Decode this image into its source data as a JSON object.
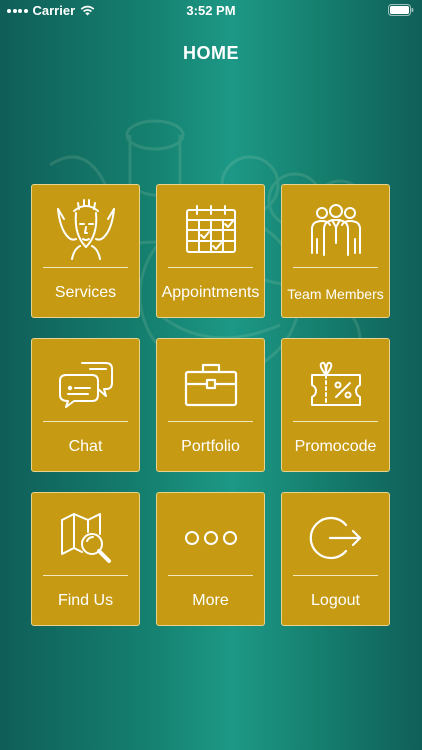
{
  "status_bar": {
    "carrier": "Carrier",
    "time": "3:52 PM"
  },
  "nav": {
    "title": "HOME"
  },
  "colors": {
    "tile_bg": "#c69a12",
    "tile_border": "#e9d48f",
    "background_center": "#1d9886",
    "background_edge": "#0f5e57"
  },
  "tiles": [
    {
      "label": "Services",
      "icon": "face-massage-icon"
    },
    {
      "label": "Appointments",
      "icon": "calendar-icon"
    },
    {
      "label": "Team Members",
      "icon": "team-icon"
    },
    {
      "label": "Chat",
      "icon": "chat-bubbles-icon"
    },
    {
      "label": "Portfolio",
      "icon": "briefcase-icon"
    },
    {
      "label": "Promocode",
      "icon": "gift-coupon-icon"
    },
    {
      "label": "Find Us",
      "icon": "map-search-icon"
    },
    {
      "label": "More",
      "icon": "more-dots-icon"
    },
    {
      "label": "Logout",
      "icon": "logout-icon"
    }
  ]
}
